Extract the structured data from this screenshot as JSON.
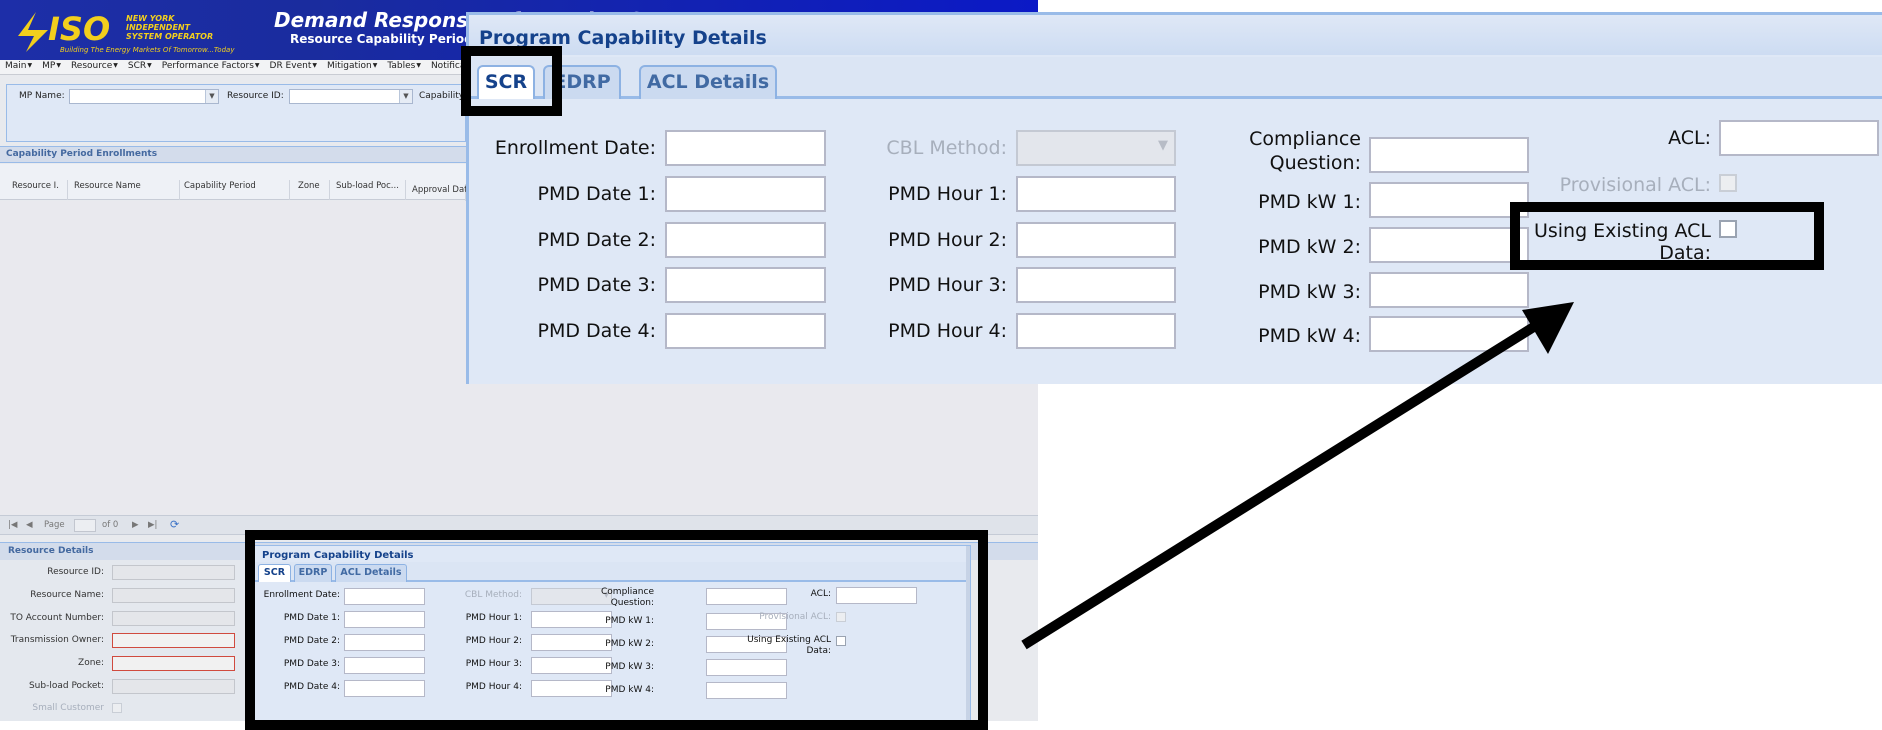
{
  "app": {
    "logo_text": "ISO",
    "logo_org": [
      "NEW YORK",
      "INDEPENDENT",
      "SYSTEM OPERATOR"
    ],
    "logo_tagline": "Building The Energy Markets Of Tomorrow...Today",
    "title": "Demand Response Information System",
    "subtitle": "Resource Capability Period Enrollment",
    "menu": [
      "Main",
      "MP",
      "Resource",
      "SCR",
      "Performance Factors",
      "DR Event",
      "Mitigation",
      "Tables",
      "Notification"
    ],
    "search": {
      "mp_name_label": "MP Name:",
      "resource_id_label": "Resource ID:",
      "capability_label": "Capability"
    },
    "enrollments": {
      "title": "Capability Period Enrollments",
      "columns": [
        "Resource I.",
        "Resource Name",
        "Capability Period",
        "Zone",
        "Sub-load Poc...",
        "Approval Dat"
      ]
    },
    "pager": {
      "page_label": "Page",
      "of_label": "of 0"
    },
    "resource_details": {
      "title": "Resource Details",
      "fields": [
        {
          "label": "Resource ID:",
          "required": false
        },
        {
          "label": "Resource Name:",
          "required": false
        },
        {
          "label": "TO Account Number:",
          "required": false
        },
        {
          "label": "Transmission Owner:",
          "required": true
        },
        {
          "label": "Zone:",
          "required": true
        },
        {
          "label": "Sub-load Pocket:",
          "required": false
        }
      ],
      "small_customer_label": "Small Customer"
    }
  },
  "panel": {
    "title": "Program Capability Details",
    "tabs": [
      "SCR",
      "EDRP",
      "ACL Details"
    ],
    "active_tab": "SCR",
    "col1": [
      "Enrollment Date:",
      "PMD Date 1:",
      "PMD Date 2:",
      "PMD Date 3:",
      "PMD Date 4:"
    ],
    "col2": [
      "CBL Method:",
      "PMD Hour 1:",
      "PMD Hour 2:",
      "PMD Hour 3:",
      "PMD Hour 4:"
    ],
    "compliance_line1": "Compliance",
    "compliance_line2": "Question:",
    "col3": [
      "PMD kW 1:",
      "PMD kW 2:",
      "PMD kW 3:",
      "PMD kW 4:"
    ],
    "acl_label": "ACL:",
    "provisional_acl_label": "Provisional ACL:",
    "using_existing_line1": "Using Existing ACL",
    "using_existing_line2": "Data:"
  },
  "colors": {
    "accent": "#15428b",
    "panel_bg": "#dfe8f6",
    "border": "#99bbe8",
    "highlight": "#000000"
  }
}
